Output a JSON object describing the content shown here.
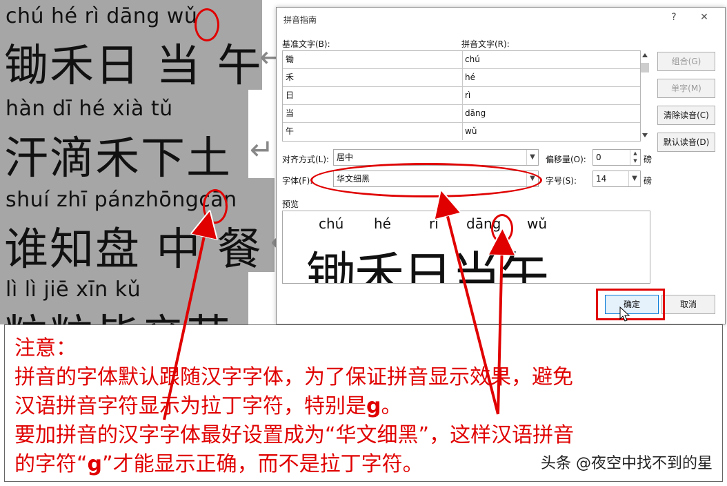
{
  "document": {
    "lines": [
      {
        "pinyin": "chú  hé   rì  dāng wǔ",
        "hanzi": "锄禾日 当 午"
      },
      {
        "pinyin": "hàn  dī   hé  xià  tǔ",
        "hanzi": "汗滴禾下土"
      },
      {
        "pinyin": "shuí zhī pánzhōngcān",
        "hanzi": "谁知盘 中 餐"
      },
      {
        "pinyin": "  lì    lì   jiē   xīn  kǔ",
        "hanzi": "粒粒皆辛苦"
      }
    ],
    "paragraph_mark": "↵"
  },
  "dialog": {
    "title": "拼音指南",
    "help": "?",
    "close": "✕",
    "base_text_label": "基准文字(B):",
    "ruby_text_label": "拼音文字(R):",
    "rows": [
      {
        "base": "锄",
        "ruby": "chú"
      },
      {
        "base": "禾",
        "ruby": "hé"
      },
      {
        "base": "日",
        "ruby": "rì"
      },
      {
        "base": "当",
        "ruby": "dāng"
      },
      {
        "base": "午",
        "ruby": "wǔ"
      }
    ],
    "buttons": {
      "group": "组合(G)",
      "mono": "单字(M)",
      "clear": "清除读音(C)",
      "default": "默认读音(D)",
      "ok": "确定",
      "cancel": "取消"
    },
    "alignment_label": "对齐方式(L):",
    "alignment_value": "居中",
    "offset_label": "偏移量(O):",
    "offset_value": "0",
    "offset_unit": "磅",
    "font_label": "字体(F):",
    "font_value": "华文细黑",
    "size_label": "字号(S):",
    "size_value": "14",
    "size_unit": "磅",
    "preview_label": "预览",
    "preview_pinyin": [
      "chú",
      "hé",
      "rì",
      "dāng",
      "wǔ"
    ],
    "preview_hanzi": "锄禾日当午"
  },
  "note": {
    "line1": "注意：",
    "line2": "拼音的字体默认跟随汉字字体，为了保证拼音显示效果，避免",
    "line3a": "汉语拼音字符显示为拉丁字符，特别是",
    "line3b": "g",
    "line3c": "。",
    "line4": "要加拼音的汉字字体最好设置成为“华文细黑”，这样汉语拼音",
    "line5a": "的字符“",
    "line5b": "g",
    "line5c": "”才能显示正确，而不是拉丁字符。",
    "watermark": "头条 @夜空中找不到的星"
  },
  "colors": {
    "highlight": "#e00000",
    "doc_band": "#a6a6a6"
  }
}
